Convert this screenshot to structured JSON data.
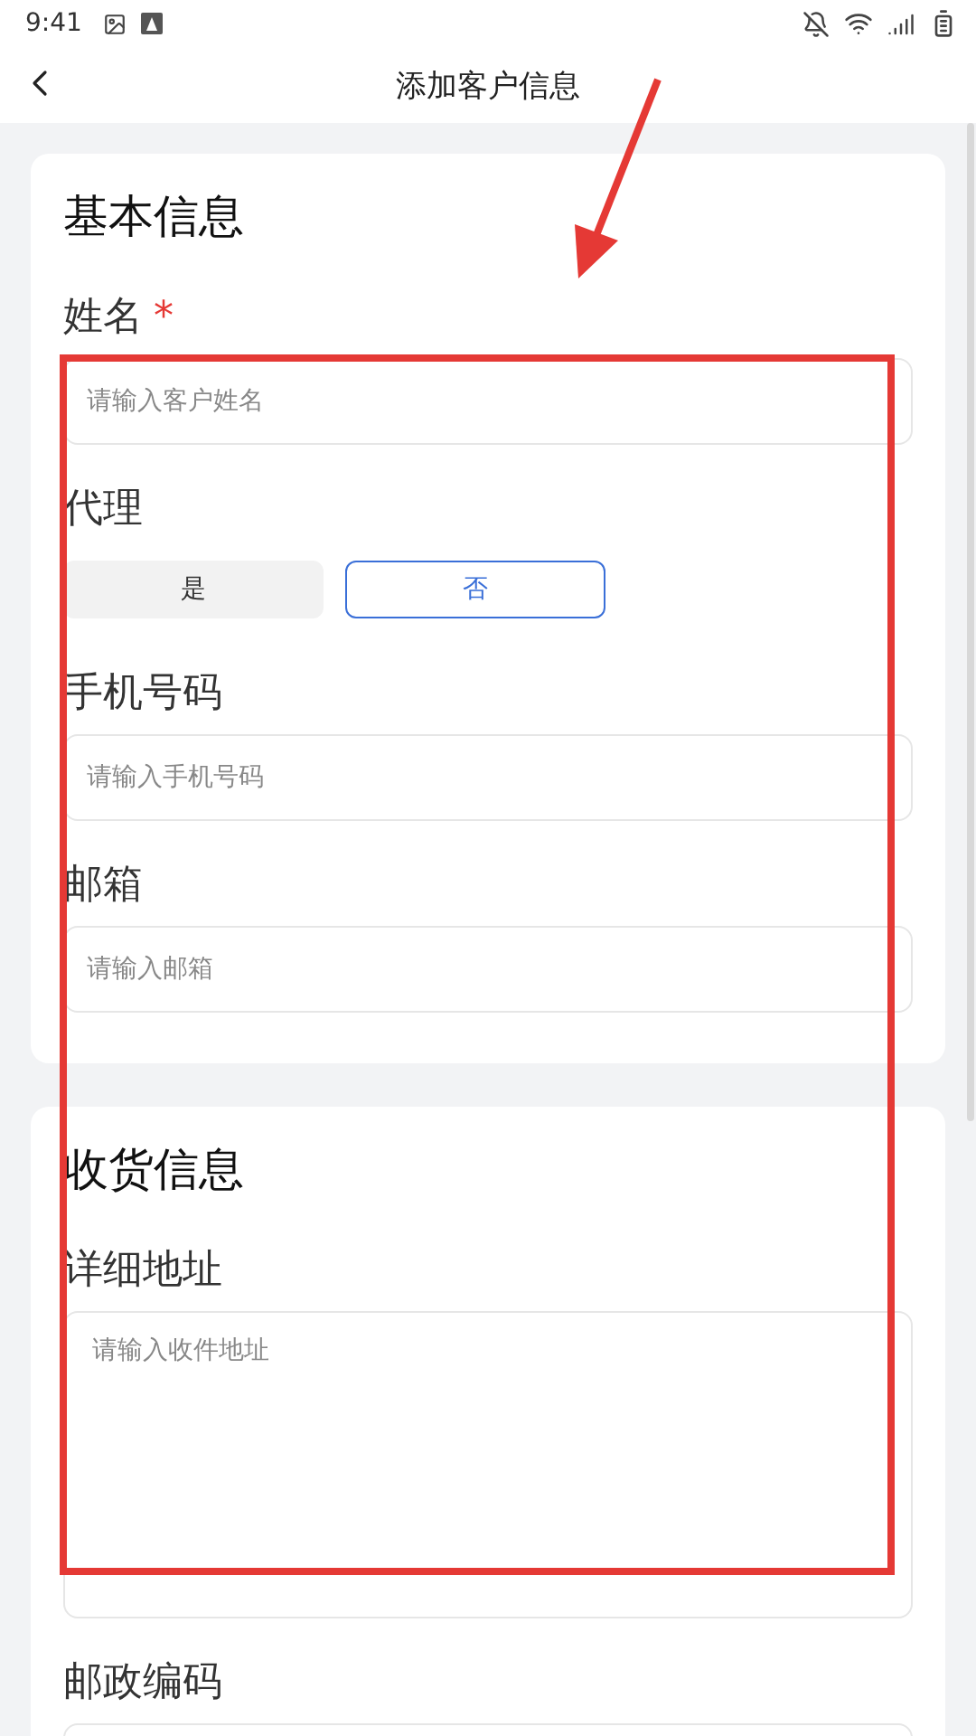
{
  "status_bar": {
    "time": "9:41"
  },
  "header": {
    "title": "添加客户信息"
  },
  "sections": [
    {
      "title": "基本信息",
      "fields": [
        {
          "kind": "input",
          "label": "姓名",
          "required_mark": "*",
          "placeholder": "请输入客户姓名"
        },
        {
          "kind": "choice",
          "label": "代理",
          "options": [
            {
              "label": "是",
              "selected": false
            },
            {
              "label": "否",
              "selected": true
            }
          ]
        },
        {
          "kind": "input",
          "label": "手机号码",
          "placeholder": "请输入手机号码"
        },
        {
          "kind": "input",
          "label": "邮箱",
          "placeholder": "请输入邮箱"
        }
      ]
    },
    {
      "title": "收货信息",
      "fields": [
        {
          "kind": "textarea",
          "label": "详细地址",
          "placeholder": "请输入收件地址"
        },
        {
          "kind": "input",
          "label": "邮政编码"
        }
      ]
    }
  ]
}
